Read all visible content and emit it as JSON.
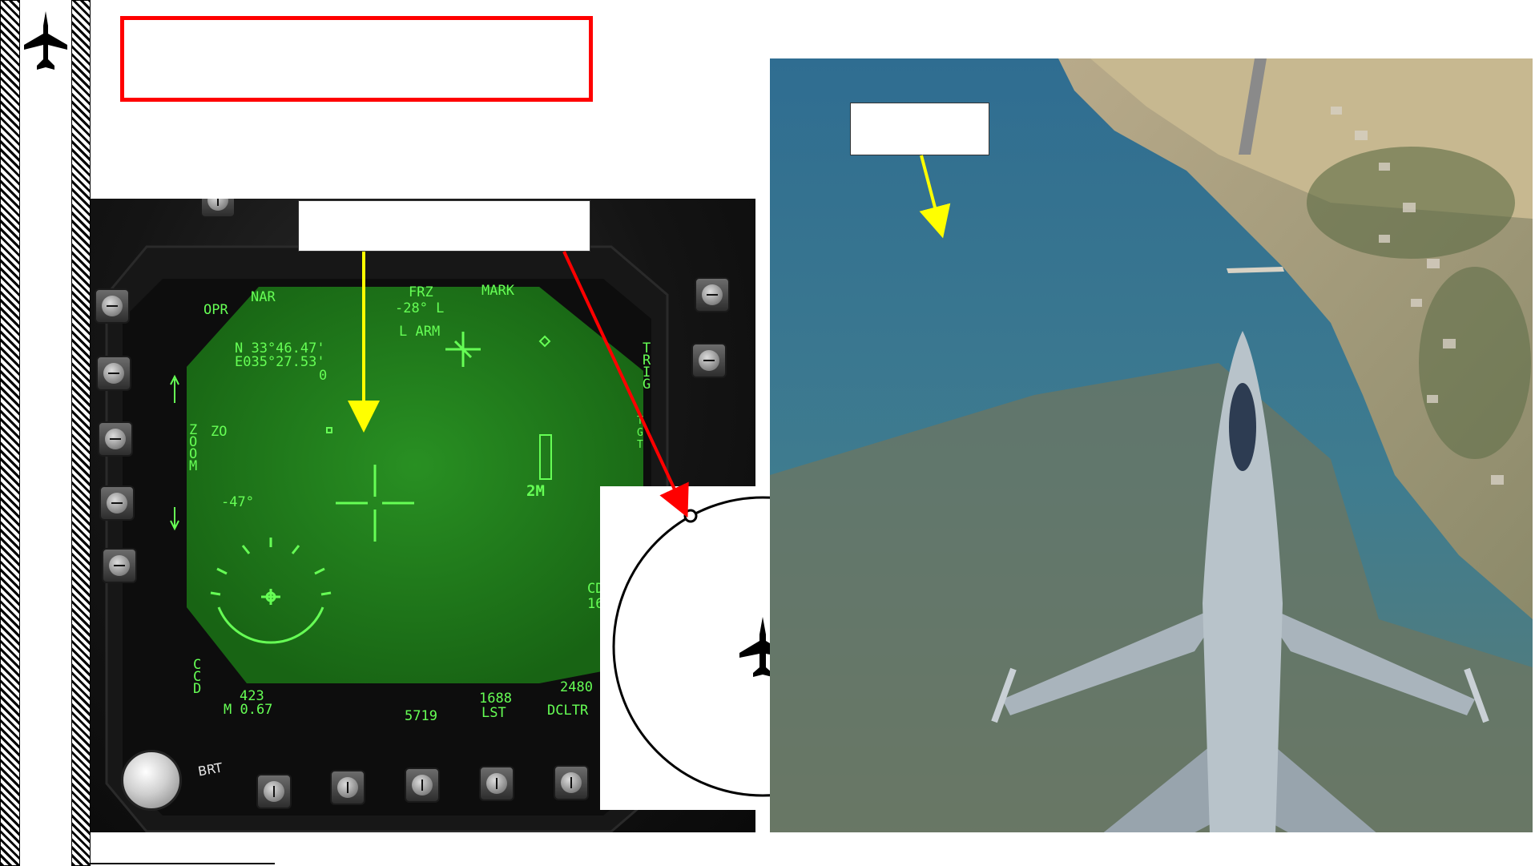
{
  "title_box": {
    "text": ""
  },
  "callouts": {
    "mfd": "",
    "photo": ""
  },
  "mfd": {
    "top_labels": {
      "opr": "OPR",
      "nar": "NAR",
      "frz": "FRZ",
      "mark": "MARK"
    },
    "depression": "-28° L",
    "arm": "L ARM",
    "coords": {
      "lat": "N 33°46.47'",
      "lon": "E035°27.53'",
      "alt": "0"
    },
    "zoom": {
      "label": "ZOOM",
      "level": "ZO"
    },
    "trig": "TRIG",
    "tgt": "TGT",
    "sensor_angle": "-47°",
    "range_mode": "2M",
    "ccd": "CCD",
    "mach": {
      "value": "423",
      "label": "M 0.67"
    },
    "bottom": {
      "alt": "5719",
      "lst_value": "1688",
      "lst": "LST",
      "dcltr_value": "2480",
      "dcltr": "DCLTR"
    },
    "right_edge": "CD\n16",
    "brt": "BRT"
  },
  "colors": {
    "mfd_symbology": "#66ff55",
    "mfd_background": "#1e7a1a",
    "title_border": "#ff0000",
    "arrow_yellow": "#ffff00",
    "arrow_red": "#ff0000"
  }
}
